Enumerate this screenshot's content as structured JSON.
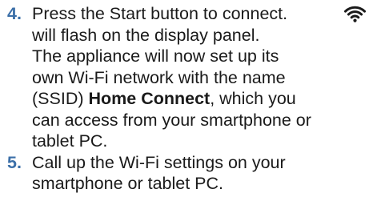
{
  "steps": [
    {
      "number": "4.",
      "lines": [
        "Press the Start button to connect.",
        "will flash on the display panel.",
        "The appliance will now set up its",
        "own Wi-Fi network with the name",
        "(SSID)",
        "Home Connect",
        ", which you",
        "can access from your smartphone or",
        "tablet PC."
      ]
    },
    {
      "number": "5.",
      "lines": [
        "Call up the Wi-Fi settings on your",
        "smartphone or tablet PC."
      ]
    }
  ],
  "icons": {
    "wifi": "wifi-icon"
  },
  "colors": {
    "step_number": "#3b6fa8",
    "text": "#1a1a1a"
  }
}
